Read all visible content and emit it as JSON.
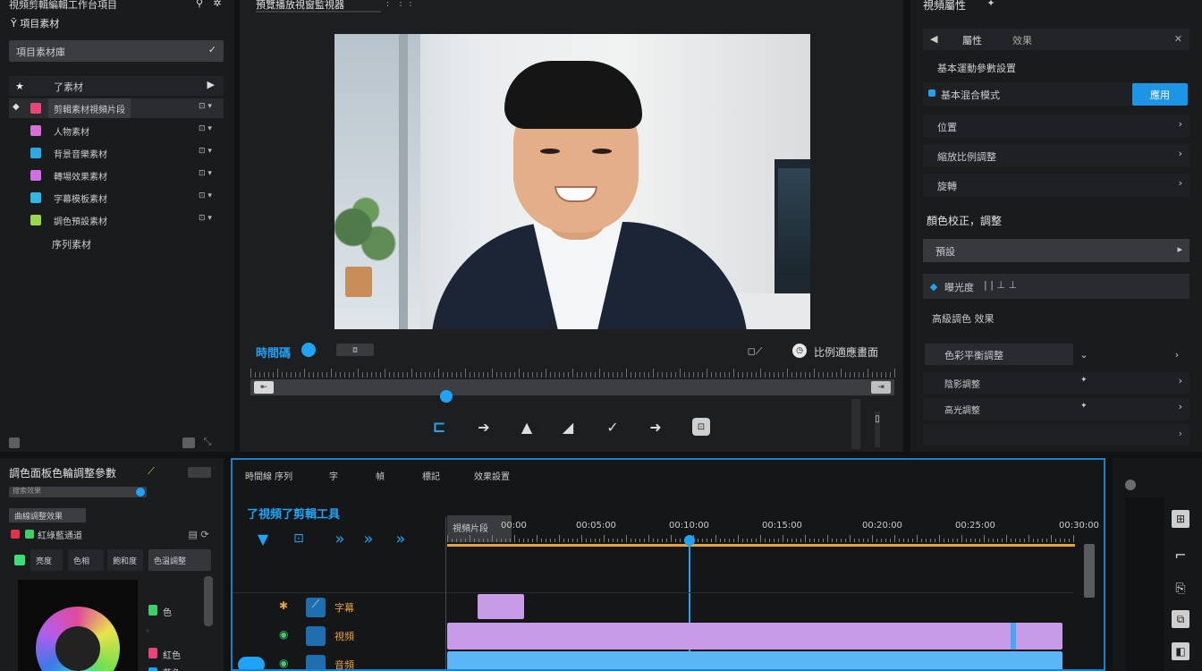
{
  "app": {
    "title": "視頻剪輯編輯工作台項目"
  },
  "left_panel": {
    "title": "Y̆ 項目素材",
    "dropdown": "項目素材庫",
    "root_label": "了素材",
    "items": [
      {
        "label": "剪輯素材視頻片段",
        "color": "#e8457a",
        "selected": true
      },
      {
        "label": "人物素材",
        "color": "#d86fd6"
      },
      {
        "label": "背景音樂素材",
        "color": "#2aa9e6"
      },
      {
        "label": "轉場效果素材",
        "color": "#d16ee6"
      },
      {
        "label": "字幕模板素材",
        "color": "#2fb7e8"
      },
      {
        "label": "調色預設素材",
        "color": "#9ad64b"
      }
    ],
    "extra": "序列素材"
  },
  "preview": {
    "title": "預覽播放視窗監視器",
    "timecode": "時間碼",
    "zoom_label": "比例適應畫面",
    "transport": [
      "下一幀",
      "後退",
      "播放",
      "前進",
      "標記",
      "導出"
    ]
  },
  "right_panel": {
    "title": "視頻屬性",
    "top_tab": "屬性",
    "top_tab2": "效果",
    "subtitle": "基本運動參數設置",
    "blend_label": "基本混合模式",
    "apply_button": "應用",
    "rows": [
      "位置",
      "縮放比例調整",
      "旋轉"
    ],
    "section": "顏色校正，調整",
    "dropdown": "預設",
    "slider_label": "曝光度",
    "section2": "高級調色 效果",
    "sub_dropdown": "色彩平衡調整",
    "sub_rows": [
      "陰影調整",
      "高光調整"
    ]
  },
  "color_panel": {
    "title": "調色面板色輪調整參數",
    "search_placeholder": "搜索效果",
    "filter_label": "曲線調整效果",
    "legend": "紅綠藍通道",
    "tabs": [
      "亮度",
      "色相",
      "飽和度",
      "色溫調整"
    ],
    "right_labels": [
      "色",
      "紅色",
      "藍色"
    ]
  },
  "timeline": {
    "tabs": [
      "時間線 序列",
      "字",
      "幀",
      "標記",
      "效果設置"
    ],
    "title": "了視頻了剪輯工具",
    "selected_clip_label": "視頻片段",
    "ruler": [
      "00:00",
      "00:05:00",
      "00:10:00",
      "00:15:00",
      "00:20:00",
      "00:25:00",
      "00:30:00"
    ],
    "tracks": [
      {
        "name": "字幕",
        "color": "#e8a33a"
      },
      {
        "name": "視頻",
        "color": "#e8a33a"
      },
      {
        "name": "音頻",
        "color": "#e8a33a"
      }
    ]
  },
  "colors": {
    "accent": "#1fa3f4",
    "playhead": "#1fa3f4",
    "work_area": "#e8a33a",
    "video_clip": "#c79be8",
    "audio_clip": "#5ab6f5"
  }
}
